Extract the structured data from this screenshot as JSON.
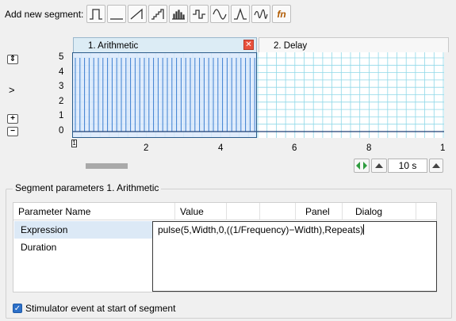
{
  "toolbar": {
    "label": "Add new segment:",
    "buttons": [
      {
        "name": "pulse-segment-button",
        "icon": "pulse-icon"
      },
      {
        "name": "constant-segment-button",
        "icon": "constant-icon"
      },
      {
        "name": "ramp-segment-button",
        "icon": "ramp-icon"
      },
      {
        "name": "staircase-segment-button",
        "icon": "staircase-icon"
      },
      {
        "name": "pulse-train-segment-button",
        "icon": "pulse-train-icon"
      },
      {
        "name": "biphasic-segment-button",
        "icon": "biphasic-icon"
      },
      {
        "name": "sine-segment-button",
        "icon": "sine-icon"
      },
      {
        "name": "spike-segment-button",
        "icon": "spike-icon"
      },
      {
        "name": "noise-segment-button",
        "icon": "noise-icon"
      },
      {
        "name": "function-segment-button",
        "icon": "function-icon",
        "label": "fn"
      }
    ]
  },
  "tabs": [
    {
      "label": "1. Arithmetic",
      "active": true
    },
    {
      "label": "2. Delay",
      "active": false
    }
  ],
  "plot": {
    "y_ticks": [
      "5",
      "4",
      "3",
      "2",
      "1",
      "0",
      "-1"
    ],
    "x_ticks": [
      "2",
      "4",
      "6",
      "8",
      "1"
    ],
    "segment_marker": "1",
    "time_window": "10 s",
    "grid_color": "#8fd8e8",
    "highlight_color": "#dbe9fb",
    "pulse_color": "#3a7ed0"
  },
  "group": {
    "title": "Segment parameters 1. Arithmetic",
    "columns": [
      "Parameter Name",
      "Value",
      "Panel",
      "Dialog"
    ],
    "rows": [
      {
        "label": "Expression",
        "selected": true
      },
      {
        "label": "Duration",
        "selected": false
      }
    ],
    "expression_value": "pulse(5,Width,0,((1/Frequency)−Width),Repeats)"
  },
  "stim_event": {
    "label": "Stimulator event at start of segment",
    "checked": true
  }
}
